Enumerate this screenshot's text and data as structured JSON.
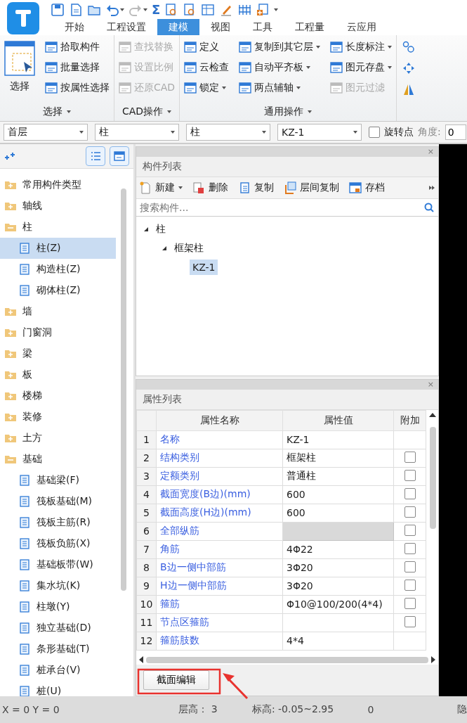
{
  "quick_access": [
    {
      "kind": "save"
    },
    {
      "kind": "new"
    },
    {
      "kind": "open"
    },
    {
      "kind": "undo",
      "dropdown": true,
      "disabled": false
    },
    {
      "kind": "redo",
      "dropdown": true,
      "disabled": true
    },
    {
      "kind": "glyph",
      "text": "Σ"
    },
    {
      "kind": "find"
    },
    {
      "kind": "find"
    },
    {
      "kind": "table"
    },
    {
      "kind": "pen"
    },
    {
      "kind": "grid"
    },
    {
      "kind": "add"
    }
  ],
  "tabs": [
    {
      "label": "开始",
      "selected": false
    },
    {
      "label": "工程设置",
      "selected": false
    },
    {
      "label": "建模",
      "selected": true
    },
    {
      "label": "视图",
      "selected": false
    },
    {
      "label": "工具",
      "selected": false
    },
    {
      "label": "工程量",
      "selected": false
    },
    {
      "label": "云应用",
      "selected": false
    }
  ],
  "ribbon": {
    "groups": [
      {
        "label": "选择",
        "primary": {
          "label": "选择"
        },
        "columns": [
          [
            {
              "label": "拾取构件",
              "disabled": false,
              "dropdown": false
            },
            {
              "label": "批量选择",
              "disabled": false,
              "dropdown": false
            },
            {
              "label": "按属性选择",
              "disabled": false,
              "dropdown": false
            }
          ]
        ]
      },
      {
        "label": "CAD操作",
        "columns": [
          [
            {
              "label": "查找替换",
              "disabled": true,
              "dropdown": false
            },
            {
              "label": "设置比例",
              "disabled": true,
              "dropdown": false
            },
            {
              "label": "还原CAD",
              "disabled": true,
              "dropdown": false
            }
          ]
        ]
      },
      {
        "label": "通用操作",
        "columns": [
          [
            {
              "label": "定义",
              "disabled": false,
              "dropdown": false
            },
            {
              "label": "云检查",
              "disabled": false,
              "dropdown": false
            },
            {
              "label": "锁定",
              "disabled": false,
              "dropdown": true
            }
          ],
          [
            {
              "label": "复制到其它层",
              "disabled": false,
              "dropdown": true
            },
            {
              "label": "自动平齐板",
              "disabled": false,
              "dropdown": true
            },
            {
              "label": "两点辅轴",
              "disabled": false,
              "dropdown": true
            }
          ],
          [
            {
              "label": "长度标注",
              "disabled": false,
              "dropdown": true
            },
            {
              "label": "图元存盘",
              "disabled": false,
              "dropdown": true
            },
            {
              "label": "图元过滤",
              "disabled": true,
              "dropdown": false
            }
          ]
        ]
      }
    ]
  },
  "toolbar": {
    "selectors": [
      {
        "value": "首层"
      },
      {
        "value": "柱"
      },
      {
        "value": "柱"
      },
      {
        "value": "KZ-1"
      }
    ],
    "rotate_point": {
      "label": "旋转点",
      "checked": false
    },
    "angle": {
      "label": "角度:",
      "value": "0"
    }
  },
  "category_tree": [
    {
      "label": "常用构件类型",
      "expanded": false,
      "selected": false
    },
    {
      "label": "轴线",
      "expanded": false,
      "selected": false
    },
    {
      "label": "柱",
      "expanded": true,
      "selected": false,
      "children": [
        {
          "label": "柱(Z)",
          "selected": true
        },
        {
          "label": "构造柱(Z)",
          "selected": false
        },
        {
          "label": "砌体柱(Z)",
          "selected": false
        }
      ]
    },
    {
      "label": "墙",
      "expanded": false,
      "selected": false
    },
    {
      "label": "门窗洞",
      "expanded": false,
      "selected": false
    },
    {
      "label": "梁",
      "expanded": false,
      "selected": false
    },
    {
      "label": "板",
      "expanded": false,
      "selected": false
    },
    {
      "label": "楼梯",
      "expanded": false,
      "selected": false
    },
    {
      "label": "装修",
      "expanded": false,
      "selected": false
    },
    {
      "label": "土方",
      "expanded": false,
      "selected": false
    },
    {
      "label": "基础",
      "expanded": true,
      "selected": false,
      "children": [
        {
          "label": "基础梁(F)",
          "selected": false
        },
        {
          "label": "筏板基础(M)",
          "selected": false
        },
        {
          "label": "筏板主筋(R)",
          "selected": false
        },
        {
          "label": "筏板负筋(X)",
          "selected": false
        },
        {
          "label": "基础板带(W)",
          "selected": false
        },
        {
          "label": "集水坑(K)",
          "selected": false
        },
        {
          "label": "柱墩(Y)",
          "selected": false
        },
        {
          "label": "独立基础(D)",
          "selected": false
        },
        {
          "label": "条形基础(T)",
          "selected": false
        },
        {
          "label": "桩承台(V)",
          "selected": false
        },
        {
          "label": "桩(U)",
          "selected": false
        }
      ]
    }
  ],
  "component_list": {
    "close": "×",
    "title": "构件列表",
    "actions": [
      {
        "label": "新建",
        "dropdown": true
      },
      {
        "label": "删除",
        "dropdown": false
      },
      {
        "label": "复制",
        "dropdown": false
      },
      {
        "label": "层间复制",
        "dropdown": false
      },
      {
        "label": "存档",
        "dropdown": false
      }
    ],
    "search": {
      "placeholder": "搜索构件..."
    },
    "tree": [
      {
        "label": "柱",
        "expanded": true,
        "selected": false,
        "children": [
          {
            "label": "框架柱",
            "expanded": true,
            "selected": false,
            "children": [
              {
                "label": "KZ-1",
                "selected": true
              }
            ]
          }
        ]
      }
    ]
  },
  "property_list": {
    "close": "×",
    "title": "属性列表",
    "columns": [
      "属性名称",
      "属性值",
      "附加"
    ],
    "rows": [
      {
        "index": "1",
        "name": "名称",
        "value": "KZ-1",
        "shaded": false
      },
      {
        "index": "2",
        "name": "结构类别",
        "value": "框架柱",
        "shaded": false,
        "checked": false
      },
      {
        "index": "3",
        "name": "定额类别",
        "value": "普通柱",
        "shaded": false,
        "checked": false
      },
      {
        "index": "4",
        "name": "截面宽度(B边)(mm)",
        "value": "600",
        "shaded": false,
        "checked": false
      },
      {
        "index": "5",
        "name": "截面高度(H边)(mm)",
        "value": "600",
        "shaded": false,
        "checked": false
      },
      {
        "index": "6",
        "name": "全部纵筋",
        "shaded": true,
        "checked": false
      },
      {
        "index": "7",
        "name": "角筋",
        "value": "4Φ22",
        "shaded": false,
        "checked": false
      },
      {
        "index": "8",
        "name": "B边一侧中部筋",
        "value": "3Φ20",
        "shaded": false,
        "checked": false
      },
      {
        "index": "9",
        "name": "H边一侧中部筋",
        "value": "3Φ20",
        "shaded": false,
        "checked": false
      },
      {
        "index": "10",
        "name": "箍筋",
        "value": "Φ10@100/200(4*4)",
        "shaded": false,
        "checked": false
      },
      {
        "index": "11",
        "name": "节点区箍筋",
        "shaded": false,
        "checked": false
      },
      {
        "index": "12",
        "name": "箍筋肢数",
        "value": "4*4",
        "shaded": false
      }
    ]
  },
  "bottom_button": {
    "label": "截面编辑"
  },
  "status_bar": [
    "X = 0 Y = 0",
    "层高： 3",
    "标高: -0.05~2.95",
    "0",
    "隐"
  ]
}
